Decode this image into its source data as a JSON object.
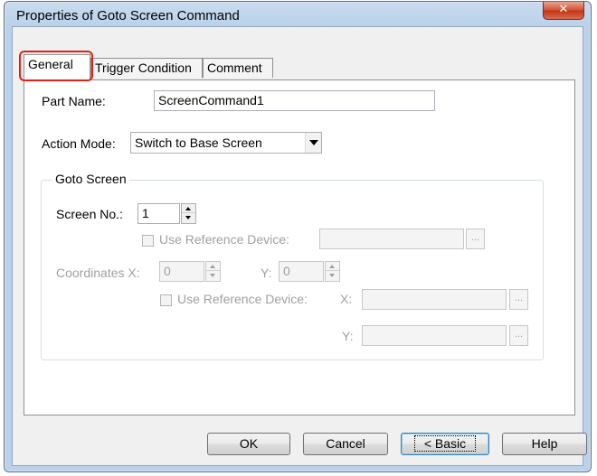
{
  "window": {
    "title": "Properties of Goto Screen Command",
    "close_glyph": "✕"
  },
  "tabs": [
    {
      "label": "General",
      "active": true
    },
    {
      "label": "Trigger Condition",
      "active": false
    },
    {
      "label": "Comment",
      "active": false
    }
  ],
  "general": {
    "part_name_label": "Part Name:",
    "part_name_value": "ScreenCommand1",
    "action_mode_label": "Action Mode:",
    "action_mode_value": "Switch to Base Screen",
    "goto_screen": {
      "group_title": "Goto Screen",
      "screen_no_label": "Screen No.:",
      "screen_no_value": "1",
      "use_ref_device_label": "Use Reference Device:",
      "use_ref_device_value": "",
      "coordinates_label": "Coordinates X:",
      "x_value": "0",
      "y_label": "Y:",
      "y_value": "0",
      "coord_use_ref_label": "Use Reference Device:",
      "coord_ref_x_label": "X:",
      "coord_ref_x_value": "",
      "coord_ref_y_label": "Y:",
      "coord_ref_y_value": "",
      "browse_glyph": "..."
    }
  },
  "buttons": {
    "ok": "OK",
    "cancel": "Cancel",
    "basic": "< Basic",
    "help": "Help"
  },
  "colors": {
    "highlight_ring": "#e0201a",
    "titlebar": "#b9d1ea",
    "close": "#c3361a"
  }
}
